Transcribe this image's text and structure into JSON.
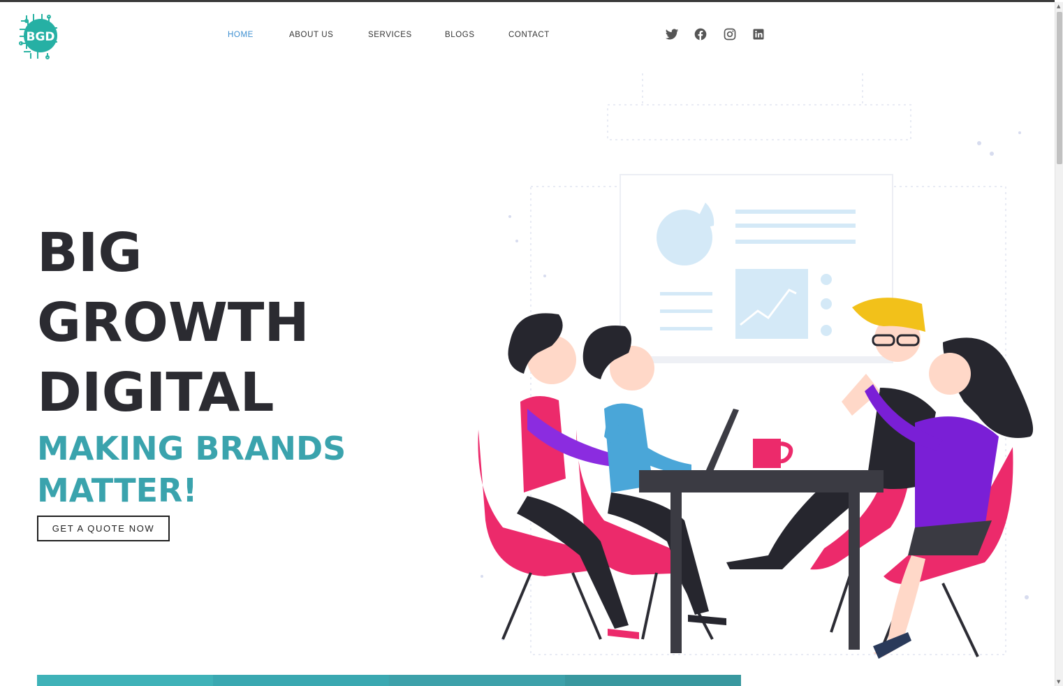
{
  "header": {
    "logo_text": "BGD",
    "nav": [
      {
        "label": "HOME",
        "active": true
      },
      {
        "label": "ABOUT US",
        "active": false
      },
      {
        "label": "SERVICES",
        "active": false
      },
      {
        "label": "BLOGS",
        "active": false
      },
      {
        "label": "CONTACT",
        "active": false
      }
    ],
    "social": [
      "twitter-icon",
      "facebook-icon",
      "instagram-icon",
      "linkedin-icon"
    ]
  },
  "hero": {
    "title_lines": [
      "BIG",
      "GROWTH",
      "DIGITAL"
    ],
    "subtitle_lines": [
      "MAKING BRANDS",
      "MATTER!"
    ],
    "cta_label": "GET A QUOTE NOW"
  },
  "colors": {
    "accent": "#3aa3ad",
    "nav_active": "#3d8fd1",
    "heading": "#2b2b31",
    "bottom_bar": [
      "#3fb2b8",
      "#3aa8b1",
      "#3da1aa",
      "#39989f"
    ]
  }
}
